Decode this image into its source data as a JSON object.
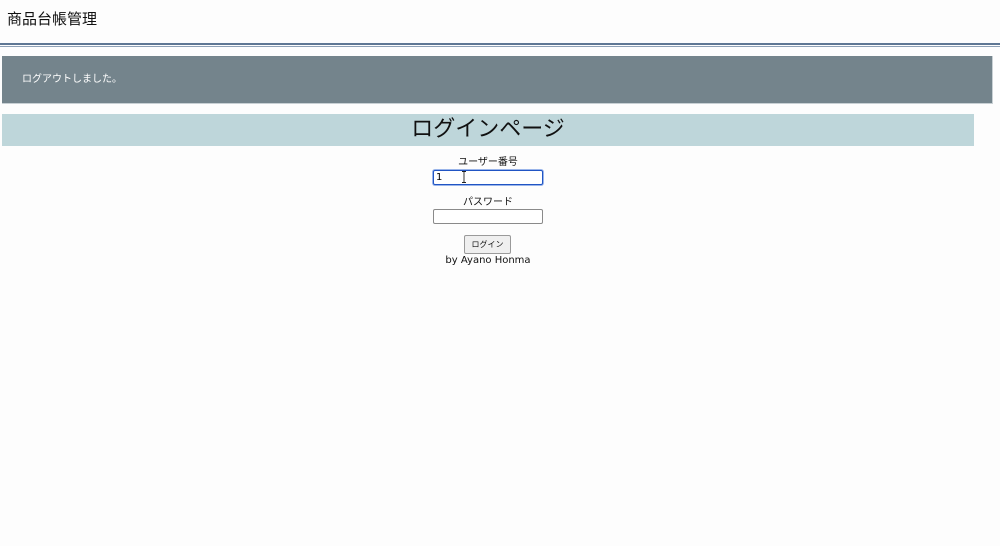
{
  "header": {
    "title": "商品台帳管理"
  },
  "flash": {
    "message": "ログアウトしました。"
  },
  "page": {
    "heading": "ログインページ"
  },
  "login_form": {
    "user_number_label": "ユーザー番号",
    "user_number_value": "1",
    "password_label": "パスワード",
    "password_value": "",
    "submit_label": "ログイン"
  },
  "footer": {
    "credit": "by Ayano Honma"
  },
  "colors": {
    "flash_background": "#74848c",
    "heading_background": "#bed6da",
    "header_rule": "#5f7794",
    "focus_border": "#2155c4"
  },
  "icons": {
    "text_cursor": "i-beam-cursor-icon"
  }
}
